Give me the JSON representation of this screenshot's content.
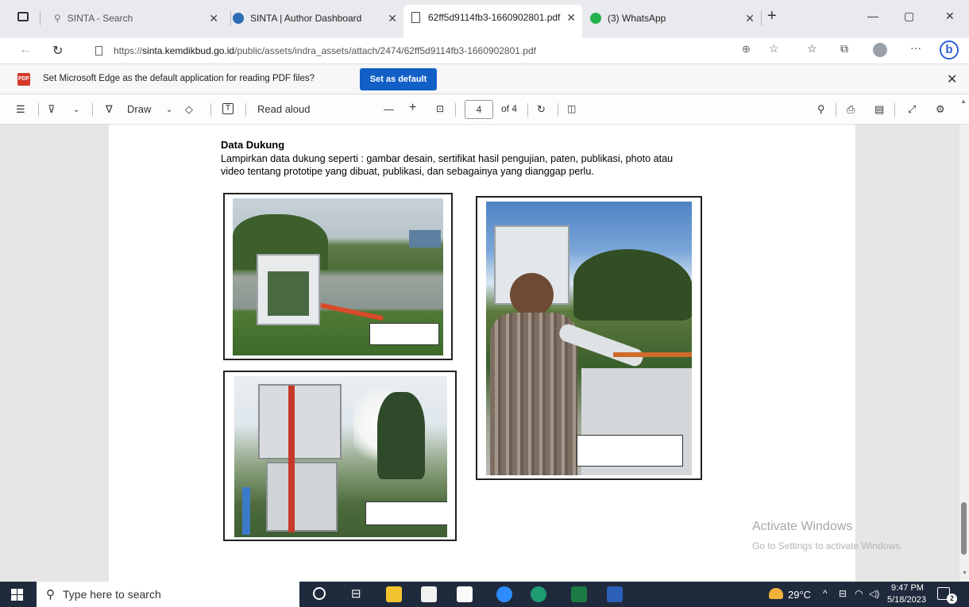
{
  "browser": {
    "tabs": [
      {
        "title": "SINTA - Search"
      },
      {
        "title": "SINTA | Author Dashboard"
      },
      {
        "title": "62ff5d9114fb3-1660902801.pdf"
      },
      {
        "title": "(3) WhatsApp"
      }
    ],
    "url_prefix": "https://",
    "url_domain": "sinta.kemdikbud.go.id",
    "url_path": "/public/assets/indra_assets/attach/2474/62ff5d9114fb3-1660902801.pdf"
  },
  "notice": {
    "text": "Set Microsoft Edge as the default application for reading PDF files?",
    "button": "Set as default"
  },
  "pdf_toolbar": {
    "draw": "Draw",
    "read_aloud": "Read aloud",
    "page": "4",
    "of": "of 4"
  },
  "document": {
    "heading": "Data Dukung",
    "body_line1": "Lampirkan data dukung seperti : gambar desain, sertifikat hasil pengujian, paten, publikasi, photo atau",
    "body_line2": "video tentang prototipe yang dibuat, publikasi, dan sebagainya yang dianggap perlu."
  },
  "watermark": {
    "line1": "Activate Windows",
    "line2": "Go to Settings to activate Windows."
  },
  "taskbar": {
    "search_placeholder": "Type here to search",
    "temp": "29°C",
    "time": "9:47 PM",
    "date": "5/18/2023",
    "notif_count": "2"
  }
}
